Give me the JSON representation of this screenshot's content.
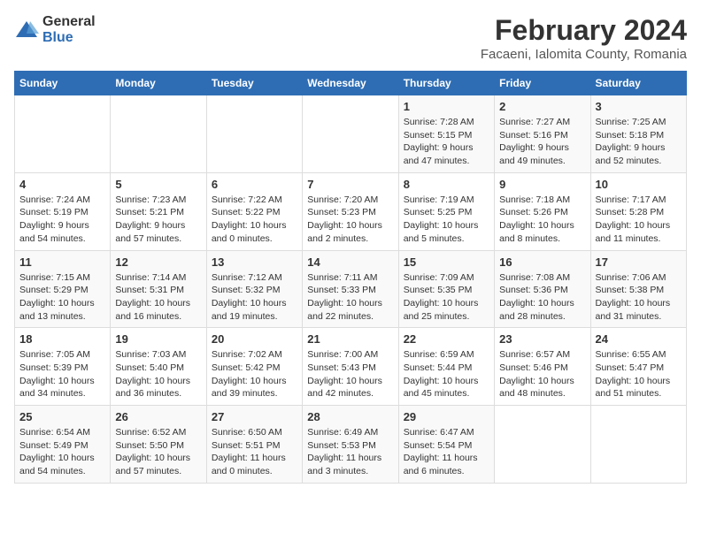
{
  "logo": {
    "general": "General",
    "blue": "Blue"
  },
  "header": {
    "title": "February 2024",
    "subtitle": "Facaeni, Ialomita County, Romania"
  },
  "weekdays": [
    "Sunday",
    "Monday",
    "Tuesday",
    "Wednesday",
    "Thursday",
    "Friday",
    "Saturday"
  ],
  "weeks": [
    [
      {
        "day": "",
        "info": ""
      },
      {
        "day": "",
        "info": ""
      },
      {
        "day": "",
        "info": ""
      },
      {
        "day": "",
        "info": ""
      },
      {
        "day": "1",
        "info": "Sunrise: 7:28 AM\nSunset: 5:15 PM\nDaylight: 9 hours\nand 47 minutes."
      },
      {
        "day": "2",
        "info": "Sunrise: 7:27 AM\nSunset: 5:16 PM\nDaylight: 9 hours\nand 49 minutes."
      },
      {
        "day": "3",
        "info": "Sunrise: 7:25 AM\nSunset: 5:18 PM\nDaylight: 9 hours\nand 52 minutes."
      }
    ],
    [
      {
        "day": "4",
        "info": "Sunrise: 7:24 AM\nSunset: 5:19 PM\nDaylight: 9 hours\nand 54 minutes."
      },
      {
        "day": "5",
        "info": "Sunrise: 7:23 AM\nSunset: 5:21 PM\nDaylight: 9 hours\nand 57 minutes."
      },
      {
        "day": "6",
        "info": "Sunrise: 7:22 AM\nSunset: 5:22 PM\nDaylight: 10 hours\nand 0 minutes."
      },
      {
        "day": "7",
        "info": "Sunrise: 7:20 AM\nSunset: 5:23 PM\nDaylight: 10 hours\nand 2 minutes."
      },
      {
        "day": "8",
        "info": "Sunrise: 7:19 AM\nSunset: 5:25 PM\nDaylight: 10 hours\nand 5 minutes."
      },
      {
        "day": "9",
        "info": "Sunrise: 7:18 AM\nSunset: 5:26 PM\nDaylight: 10 hours\nand 8 minutes."
      },
      {
        "day": "10",
        "info": "Sunrise: 7:17 AM\nSunset: 5:28 PM\nDaylight: 10 hours\nand 11 minutes."
      }
    ],
    [
      {
        "day": "11",
        "info": "Sunrise: 7:15 AM\nSunset: 5:29 PM\nDaylight: 10 hours\nand 13 minutes."
      },
      {
        "day": "12",
        "info": "Sunrise: 7:14 AM\nSunset: 5:31 PM\nDaylight: 10 hours\nand 16 minutes."
      },
      {
        "day": "13",
        "info": "Sunrise: 7:12 AM\nSunset: 5:32 PM\nDaylight: 10 hours\nand 19 minutes."
      },
      {
        "day": "14",
        "info": "Sunrise: 7:11 AM\nSunset: 5:33 PM\nDaylight: 10 hours\nand 22 minutes."
      },
      {
        "day": "15",
        "info": "Sunrise: 7:09 AM\nSunset: 5:35 PM\nDaylight: 10 hours\nand 25 minutes."
      },
      {
        "day": "16",
        "info": "Sunrise: 7:08 AM\nSunset: 5:36 PM\nDaylight: 10 hours\nand 28 minutes."
      },
      {
        "day": "17",
        "info": "Sunrise: 7:06 AM\nSunset: 5:38 PM\nDaylight: 10 hours\nand 31 minutes."
      }
    ],
    [
      {
        "day": "18",
        "info": "Sunrise: 7:05 AM\nSunset: 5:39 PM\nDaylight: 10 hours\nand 34 minutes."
      },
      {
        "day": "19",
        "info": "Sunrise: 7:03 AM\nSunset: 5:40 PM\nDaylight: 10 hours\nand 36 minutes."
      },
      {
        "day": "20",
        "info": "Sunrise: 7:02 AM\nSunset: 5:42 PM\nDaylight: 10 hours\nand 39 minutes."
      },
      {
        "day": "21",
        "info": "Sunrise: 7:00 AM\nSunset: 5:43 PM\nDaylight: 10 hours\nand 42 minutes."
      },
      {
        "day": "22",
        "info": "Sunrise: 6:59 AM\nSunset: 5:44 PM\nDaylight: 10 hours\nand 45 minutes."
      },
      {
        "day": "23",
        "info": "Sunrise: 6:57 AM\nSunset: 5:46 PM\nDaylight: 10 hours\nand 48 minutes."
      },
      {
        "day": "24",
        "info": "Sunrise: 6:55 AM\nSunset: 5:47 PM\nDaylight: 10 hours\nand 51 minutes."
      }
    ],
    [
      {
        "day": "25",
        "info": "Sunrise: 6:54 AM\nSunset: 5:49 PM\nDaylight: 10 hours\nand 54 minutes."
      },
      {
        "day": "26",
        "info": "Sunrise: 6:52 AM\nSunset: 5:50 PM\nDaylight: 10 hours\nand 57 minutes."
      },
      {
        "day": "27",
        "info": "Sunrise: 6:50 AM\nSunset: 5:51 PM\nDaylight: 11 hours\nand 0 minutes."
      },
      {
        "day": "28",
        "info": "Sunrise: 6:49 AM\nSunset: 5:53 PM\nDaylight: 11 hours\nand 3 minutes."
      },
      {
        "day": "29",
        "info": "Sunrise: 6:47 AM\nSunset: 5:54 PM\nDaylight: 11 hours\nand 6 minutes."
      },
      {
        "day": "",
        "info": ""
      },
      {
        "day": "",
        "info": ""
      }
    ]
  ]
}
